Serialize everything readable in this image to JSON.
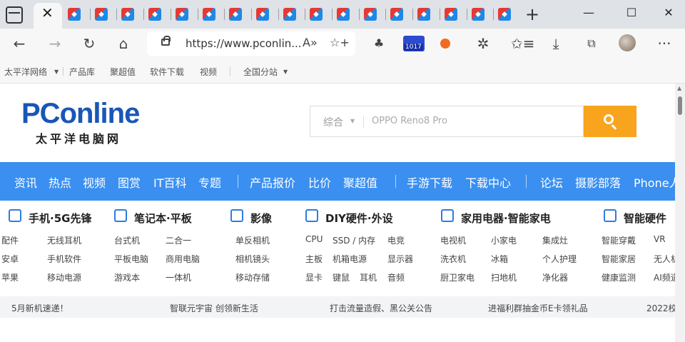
{
  "tabs": {
    "close_glyph": "✕",
    "new_tab_glyph": "+",
    "favicon_count": 17
  },
  "window": {
    "minimize": "—",
    "maximize": "☐",
    "close": "✕"
  },
  "toolbar": {
    "back": "←",
    "forward": "→",
    "refresh": "↻",
    "home": "⌂",
    "url": "https://www.pconlin...",
    "read_aloud": "A»",
    "favorite_add": "☆+",
    "badge_count": "1017",
    "favorites": "✩≡",
    "downloads": "⤓",
    "more": "···"
  },
  "favbar": {
    "items": [
      "太平洋网络",
      "产品库",
      "聚超值",
      "软件下载",
      "视频",
      "全国分站"
    ]
  },
  "site": {
    "logo_main": "PConline",
    "logo_sub": "太平洋电脑网",
    "search": {
      "category": "综合",
      "placeholder": "OPPO Reno8 Pro"
    }
  },
  "nav": [
    "资讯",
    "热点",
    "视频",
    "图赏",
    "IT百科",
    "专题",
    "产品报价",
    "比价",
    "聚超值",
    "手游下载",
    "下载中心",
    "论坛",
    "摄影部落",
    "Phone人"
  ],
  "categories": [
    {
      "title": "手机·5G先锋",
      "rows": [
        [
          "配件",
          "无线耳机"
        ],
        [
          "安卓",
          "手机软件"
        ],
        [
          "苹果",
          "移动电源"
        ]
      ]
    },
    {
      "title": "笔记本·平板",
      "rows": [
        [
          "台式机",
          "二合一"
        ],
        [
          "平板电脑",
          "商用电脑"
        ],
        [
          "游戏本",
          "一体机"
        ]
      ]
    },
    {
      "title": "影像",
      "rows": [
        [
          "单反相机"
        ],
        [
          "相机镜头"
        ],
        [
          "移动存储"
        ]
      ]
    },
    {
      "title": "DIY硬件·外设",
      "rows": [
        [
          "CPU",
          "SSD / 内存",
          "电竞"
        ],
        [
          "主板",
          "机箱电源",
          "显示器"
        ],
        [
          "显卡",
          "键鼠",
          "耳机",
          "音频"
        ]
      ]
    },
    {
      "title": "家用电器·智能家电",
      "rows": [
        [
          "电视机",
          "小家电",
          "集成灶"
        ],
        [
          "洗衣机",
          "冰箱",
          "个人护理"
        ],
        [
          "厨卫家电",
          "扫地机",
          "净化器"
        ]
      ]
    },
    {
      "title": "智能硬件",
      "rows": [
        [
          "智能穿戴",
          "VR"
        ],
        [
          "智能家居",
          "无人机"
        ],
        [
          "健康监测",
          "AI频道"
        ]
      ]
    }
  ],
  "ticker": [
    "5月新机速递！",
    "智联元宇宙 创领新生活",
    "打击流量造假、黑公关公告",
    "进福利群抽金币E卡领礼品",
    "2022校"
  ],
  "colors": {
    "brand_blue": "#3b8ff0",
    "search_orange": "#f8a41d",
    "logo_blue": "#1a56b8"
  }
}
